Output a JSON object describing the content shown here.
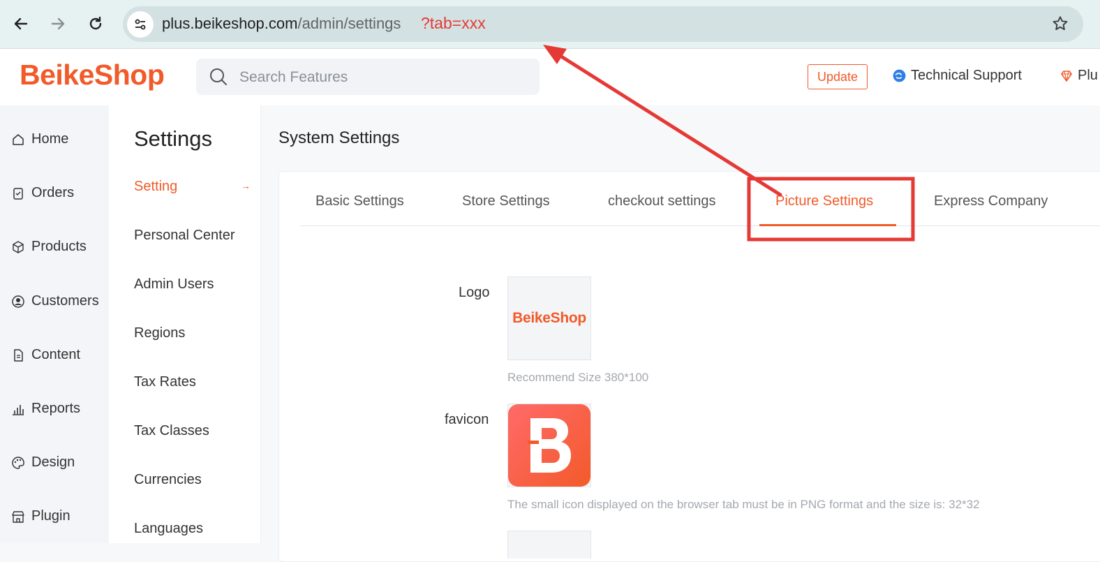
{
  "browser": {
    "url_host": "plus.beikeshop.com",
    "url_path": "/admin/settings",
    "url_query_annotation": "?tab=xxx"
  },
  "header": {
    "brand": "BeikeShop",
    "search_placeholder": "Search Features",
    "update_label": "Update",
    "support_label": "Technical Support",
    "plugin_label": "Plu"
  },
  "sidebar": {
    "items": [
      {
        "label": "Home",
        "icon": "home-icon"
      },
      {
        "label": "Orders",
        "icon": "clipboard-icon"
      },
      {
        "label": "Products",
        "icon": "box-icon"
      },
      {
        "label": "Customers",
        "icon": "user-circle-icon"
      },
      {
        "label": "Content",
        "icon": "document-icon"
      },
      {
        "label": "Reports",
        "icon": "bar-chart-icon"
      },
      {
        "label": "Design",
        "icon": "palette-icon"
      },
      {
        "label": "Plugin",
        "icon": "store-icon"
      }
    ]
  },
  "subnav": {
    "title": "Settings",
    "items": [
      {
        "label": "Setting",
        "active": true
      },
      {
        "label": "Personal Center"
      },
      {
        "label": "Admin Users"
      },
      {
        "label": "Regions"
      },
      {
        "label": "Tax Rates"
      },
      {
        "label": "Tax Classes"
      },
      {
        "label": "Currencies"
      },
      {
        "label": "Languages"
      }
    ],
    "active_arrow": "→"
  },
  "main": {
    "title": "System Settings",
    "tabs": [
      {
        "label": "Basic Settings"
      },
      {
        "label": "Store Settings"
      },
      {
        "label": "checkout settings"
      },
      {
        "label": "Picture Settings",
        "active": true
      },
      {
        "label": "Express Company"
      }
    ],
    "fields": {
      "logo_label": "Logo",
      "logo_image_text": "BeikeShop",
      "logo_hint": "Recommend Size 380*100",
      "favicon_label": "favicon",
      "favicon_hint": "The small icon displayed on the browser tab must be in PNG format and the size is: 32*32"
    }
  },
  "colors": {
    "accent": "#f15a29",
    "annotation_red": "#e53935"
  }
}
